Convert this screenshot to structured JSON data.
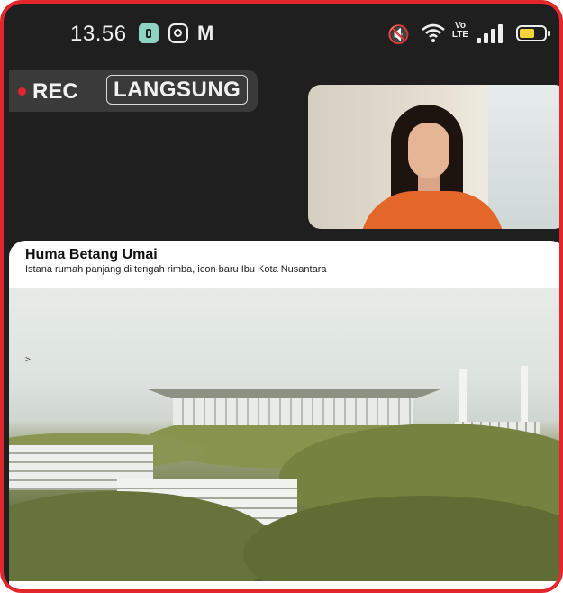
{
  "status_bar": {
    "time": "13.56",
    "apps": [
      "notes-app-icon",
      "instagram-icon",
      "gmail-icon"
    ],
    "indicators": [
      "mute-icon",
      "wifi-icon",
      "volte-icon",
      "signal-icon",
      "battery-icon"
    ],
    "volte_label": "Vo LTE",
    "battery_level": 0.6,
    "accent_battery": "#f5d43a"
  },
  "recording": {
    "rec_label": "REC",
    "live_label": "LANGSUNG",
    "rec_color": "#e3262c"
  },
  "slide": {
    "title": "Huma Betang Umai",
    "subtitle": "Istana rumah panjang di tengah rimba, icon baru Ibu Kota Nusantara"
  },
  "colors": {
    "frame_border": "#e3262c",
    "background": "#1f1f1f"
  }
}
